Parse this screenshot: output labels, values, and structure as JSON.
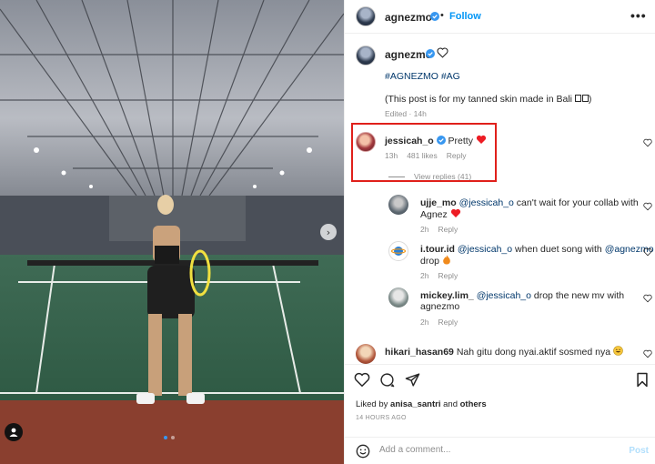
{
  "post": {
    "author": "agnezmo",
    "follow_label": "Follow",
    "more_label": "•••",
    "caption_hashtags": "#AGNEZMO #AG",
    "caption_text": "(This post is for my tanned skin made in Bali ",
    "caption_end": ")",
    "caption_meta": "Edited · 14h"
  },
  "photo": {
    "next_glyph": "›",
    "slide_count": 2,
    "active_slide": 1
  },
  "comments": [
    {
      "user": "jessicah_o",
      "text": "Pretty",
      "time": "13h",
      "likes": "481 likes",
      "reply": "Reply",
      "view_replies": "View replies (41)"
    },
    {
      "user": "ujje_mo",
      "mention": "@jessicah_o",
      "text_line1": " can't wait for your collab with",
      "text_line2": "Agnez",
      "time": "2h",
      "reply": "Reply"
    },
    {
      "user": "i.tour.id",
      "mention": "@jessicah_o",
      "text_mid": " when duet song with ",
      "mention2": "@agnezmo",
      "text_line2": "drop",
      "time": "2h",
      "reply": "Reply"
    },
    {
      "user": "mickey.lim_",
      "mention": "@jessicah_o",
      "text_line1": " drop the new mv with",
      "text_line2": "agnezmo",
      "time": "2h",
      "reply": "Reply"
    },
    {
      "user": "hikari_hasan69",
      "text": "Nah gitu dong nyai.aktif sosmed nya"
    }
  ],
  "likes": {
    "prefix": "Liked by ",
    "user": "anisa_santri",
    "and": " and ",
    "others": "others",
    "timestamp": "14 HOURS AGO"
  },
  "add_comment": {
    "placeholder": "Add a comment...",
    "post_label": "Post"
  },
  "colors": {
    "accent": "#0095f6",
    "verified": "#3897f0",
    "heart": "#ed1c24",
    "highlight_box": "#e0201b"
  }
}
